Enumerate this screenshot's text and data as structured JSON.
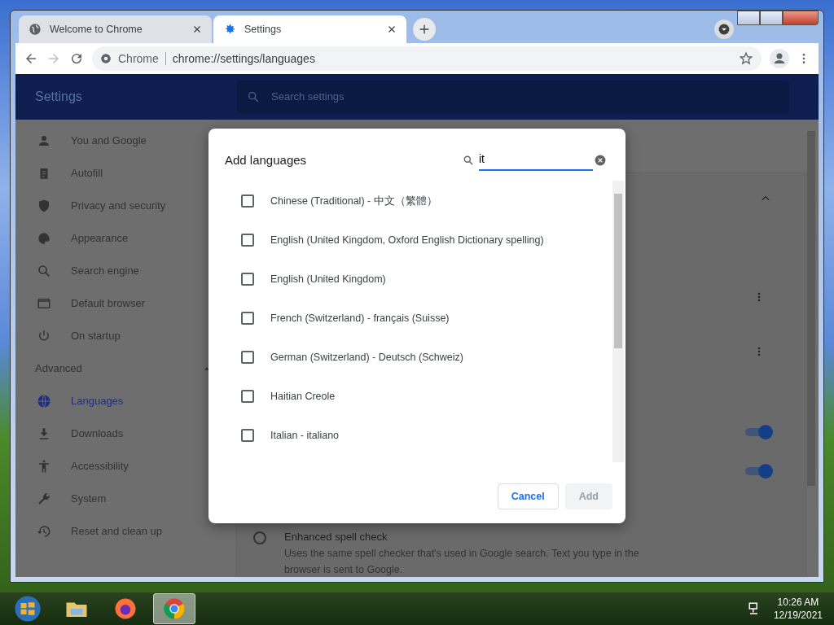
{
  "browser": {
    "tabs": [
      {
        "title": "Welcome to Chrome",
        "selected": false
      },
      {
        "title": "Settings",
        "selected": true
      }
    ],
    "address": {
      "site_label": "Chrome",
      "url": "chrome://settings/languages"
    }
  },
  "settings": {
    "title": "Settings",
    "search_placeholder": "Search settings"
  },
  "sidebar": {
    "items": [
      {
        "label": "You and Google",
        "selected": false
      },
      {
        "label": "Autofill",
        "selected": false
      },
      {
        "label": "Privacy and security",
        "selected": false
      },
      {
        "label": "Appearance",
        "selected": false
      },
      {
        "label": "Search engine",
        "selected": false
      },
      {
        "label": "Default browser",
        "selected": false
      },
      {
        "label": "On startup",
        "selected": false
      }
    ],
    "advanced": {
      "label": "Advanced",
      "expanded": true,
      "items": [
        {
          "label": "Languages",
          "selected": true
        },
        {
          "label": "Downloads",
          "selected": false
        },
        {
          "label": "Accessibility",
          "selected": false
        },
        {
          "label": "System",
          "selected": false
        },
        {
          "label": "Reset and clean up",
          "selected": false
        }
      ]
    }
  },
  "main": {
    "toggles": [
      {
        "on": true
      },
      {
        "on": true
      }
    ],
    "spell_option": {
      "label": "Enhanced spell check",
      "description": "Uses the same spell checker that's used in Google search. Text you type in the browser is sent to Google.",
      "selected": false
    }
  },
  "dialog": {
    "title": "Add languages",
    "search_value": "it",
    "languages": [
      {
        "label": "Chinese (Traditional) - 中文（繁體）",
        "checked": false
      },
      {
        "label": "English (United Kingdom, Oxford English Dictionary spelling)",
        "checked": false
      },
      {
        "label": "English (United Kingdom)",
        "checked": false
      },
      {
        "label": "French (Switzerland) - français (Suisse)",
        "checked": false
      },
      {
        "label": "German (Switzerland) - Deutsch (Schweiz)",
        "checked": false
      },
      {
        "label": "Haitian Creole",
        "checked": false
      },
      {
        "label": "Italian - italiano",
        "checked": false
      }
    ],
    "buttons": [
      {
        "label": "Cancel",
        "kind": "secondary",
        "disabled": false
      },
      {
        "label": "Add",
        "kind": "primary",
        "disabled": true
      }
    ]
  },
  "taskbar": {
    "apps": [
      {
        "selected": false
      },
      {
        "selected": false
      },
      {
        "selected": true
      }
    ],
    "time": "10:26 AM",
    "date": "12/19/2021"
  }
}
